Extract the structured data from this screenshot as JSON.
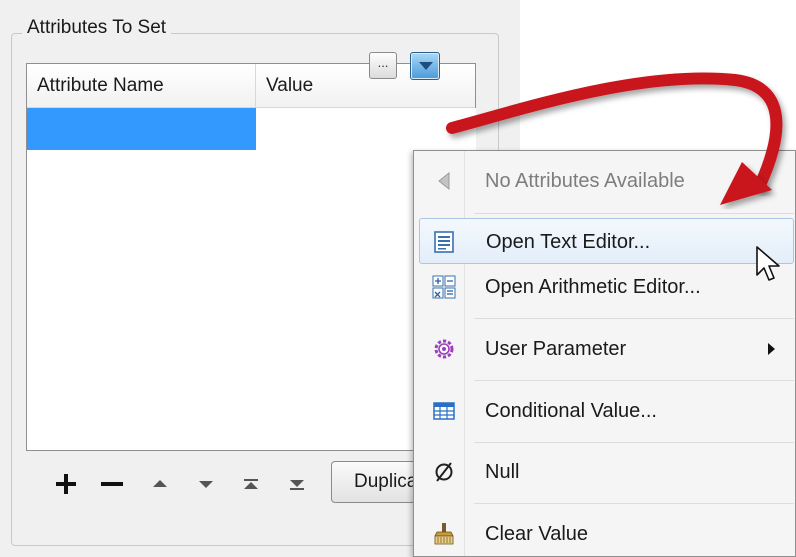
{
  "group": {
    "title": "Attributes To Set"
  },
  "table": {
    "columns": [
      "Attribute Name",
      "Value"
    ],
    "rows": [
      {
        "name": "",
        "value": ""
      }
    ],
    "dots_label": "..."
  },
  "toolbar": {
    "buttons": [
      "add",
      "remove",
      "move-up",
      "move-down",
      "move-top",
      "move-bottom"
    ],
    "duplicate_label": "Duplicate"
  },
  "menu": {
    "items": [
      {
        "label": "No Attributes Available",
        "icon": "attribute-left-arrow-icon",
        "disabled": true
      },
      {
        "label": "Open Text Editor...",
        "icon": "text-editor-icon",
        "hover": true
      },
      {
        "label": "Open Arithmetic Editor...",
        "icon": "arithmetic-editor-icon"
      },
      {
        "label": "User Parameter",
        "icon": "user-parameter-gear-icon",
        "submenu": true
      },
      {
        "label": "Conditional Value...",
        "icon": "conditional-table-icon"
      },
      {
        "label": "Null",
        "icon": "null-icon"
      },
      {
        "label": "Clear Value",
        "icon": "clear-brush-icon"
      }
    ]
  },
  "colors": {
    "selection": "#3399ff",
    "annotation_arrow": "#c8141b",
    "menu_hover": "#e3eefa"
  }
}
